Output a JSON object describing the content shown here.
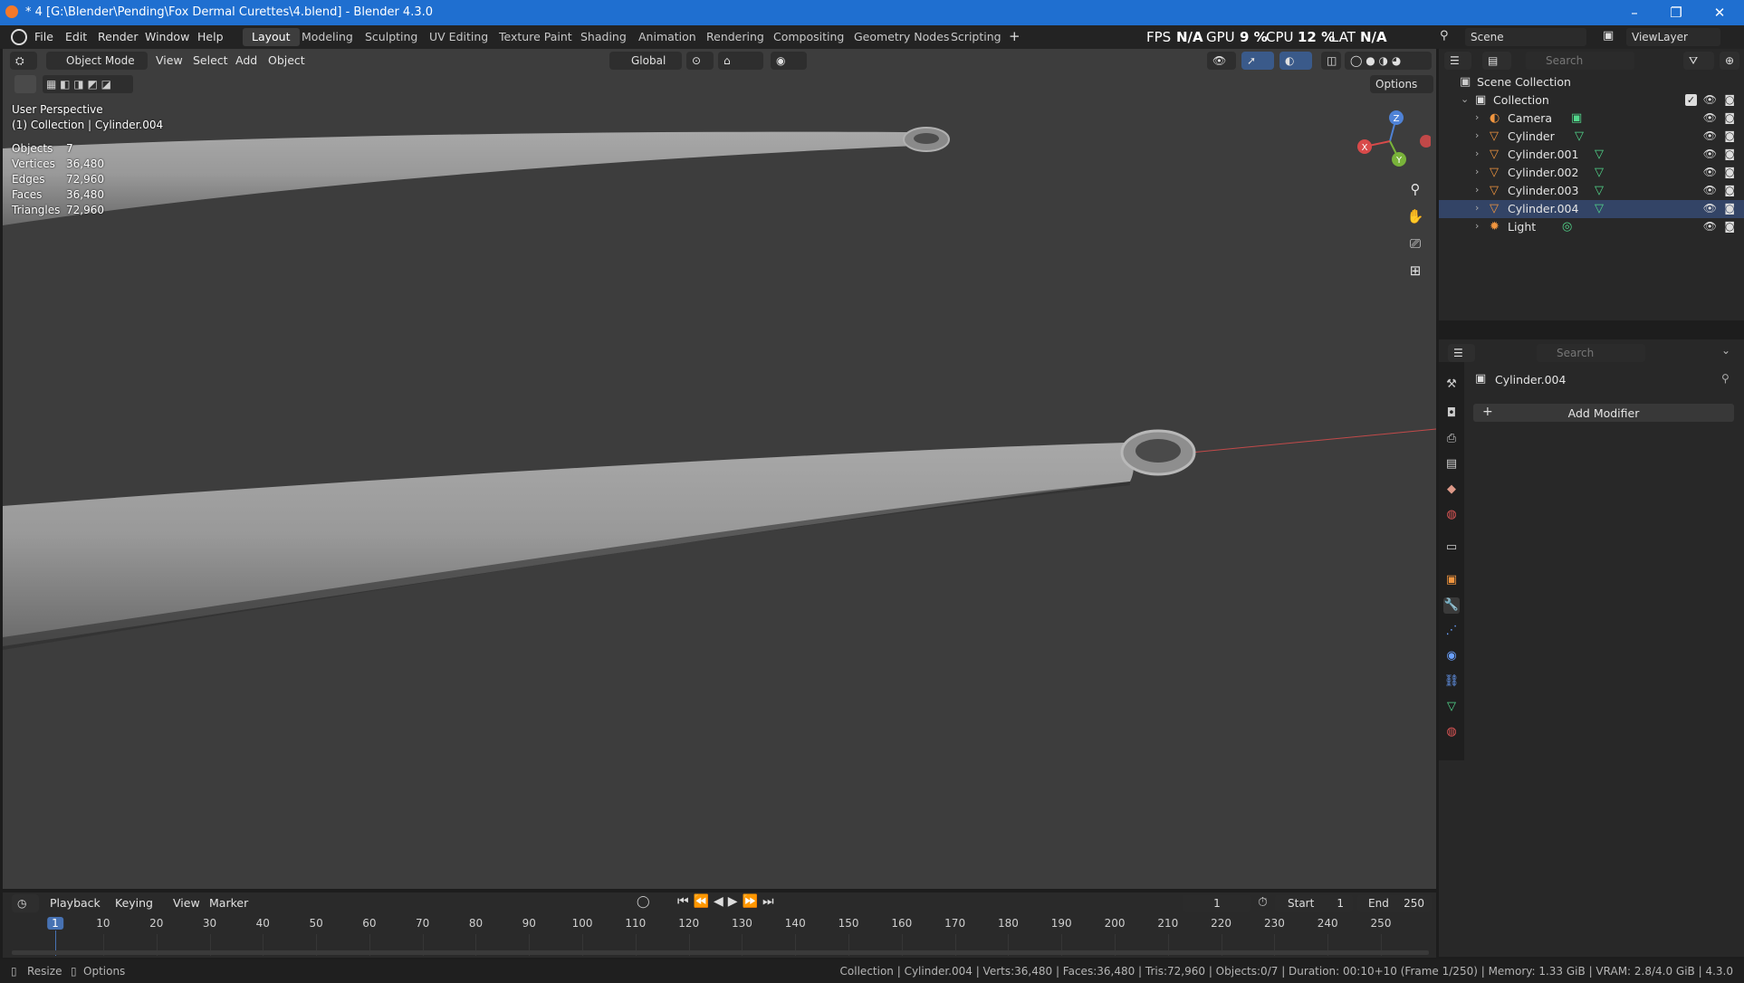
{
  "window": {
    "title": "* 4 [G:\\Blender\\Pending\\Fox Dermal Curettes\\4.blend] - Blender 4.3.0",
    "minimize": "–",
    "restore": "❐",
    "close": "✕"
  },
  "menubar": {
    "items": [
      "File",
      "Edit",
      "Render",
      "Window",
      "Help"
    ],
    "workspaces": [
      "Layout",
      "Modeling",
      "Sculpting",
      "UV Editing",
      "Texture Paint",
      "Shading",
      "Animation",
      "Rendering",
      "Compositing",
      "Geometry Nodes",
      "Scripting"
    ],
    "active_workspace": "Layout",
    "add_workspace": "+",
    "stats": {
      "fps_label": "FPS",
      "fps_value": "N/A",
      "gpu_label": "GPU",
      "gpu_value": "9 %",
      "cpu_label": "CPU",
      "cpu_value": "12 %",
      "lat_label": "LAT",
      "lat_value": "N/A"
    },
    "scene": "Scene",
    "view_layer": "ViewLayer"
  },
  "viewport": {
    "mode": "Object Mode",
    "menus": [
      "View",
      "Select",
      "Add",
      "Object"
    ],
    "orientation": "Global",
    "options": "Options",
    "perspective": "User Perspective",
    "active": "(1) Collection | Cylinder.004",
    "stats": [
      {
        "name": "Objects",
        "value": "7"
      },
      {
        "name": "Vertices",
        "value": "36,480"
      },
      {
        "name": "Edges",
        "value": "72,960"
      },
      {
        "name": "Faces",
        "value": "36,480"
      },
      {
        "name": "Triangles",
        "value": "72,960"
      }
    ],
    "gizmo": {
      "z": "Z",
      "x": "X",
      "y": "Y"
    }
  },
  "outliner": {
    "search_placeholder": "Search",
    "scene_collection": "Scene Collection",
    "collection": "Collection",
    "items": [
      {
        "name": "Camera",
        "type": "camera"
      },
      {
        "name": "Cylinder",
        "type": "mesh"
      },
      {
        "name": "Cylinder.001",
        "type": "mesh"
      },
      {
        "name": "Cylinder.002",
        "type": "mesh"
      },
      {
        "name": "Cylinder.003",
        "type": "mesh"
      },
      {
        "name": "Cylinder.004",
        "type": "mesh"
      },
      {
        "name": "Light",
        "type": "light"
      }
    ]
  },
  "properties": {
    "search_placeholder": "Search",
    "object_name": "Cylinder.004",
    "add_modifier": "Add Modifier",
    "add_modifier_plus": "+"
  },
  "timeline": {
    "menus": [
      "Playback",
      "Keying",
      "View",
      "Marker"
    ],
    "current_frame": "1",
    "start_label": "Start",
    "start_value": "1",
    "end_label": "End",
    "end_value": "250",
    "ticks": [
      "1",
      "10",
      "20",
      "30",
      "40",
      "50",
      "60",
      "70",
      "80",
      "90",
      "100",
      "110",
      "120",
      "130",
      "140",
      "150",
      "160",
      "170",
      "180",
      "190",
      "200",
      "210",
      "220",
      "230",
      "240",
      "250"
    ]
  },
  "statusbar": {
    "left1": "Resize",
    "left2": "Options",
    "right": "Collection | Cylinder.004 | Verts:36,480 | Faces:36,480 | Tris:72,960 | Objects:0/7 | Duration: 00:10+10 (Frame 1/250) | Memory: 1.33 GiB | VRAM: 2.8/4.0 GiB | 4.3.0"
  },
  "colors": {
    "titlebar": "#1f6fd0",
    "viewport_bg": "#3d3d3d",
    "accent_orange": "#f0953f",
    "mesh_data_green": "#52d68b",
    "current_frame_blue": "#4772b3"
  }
}
